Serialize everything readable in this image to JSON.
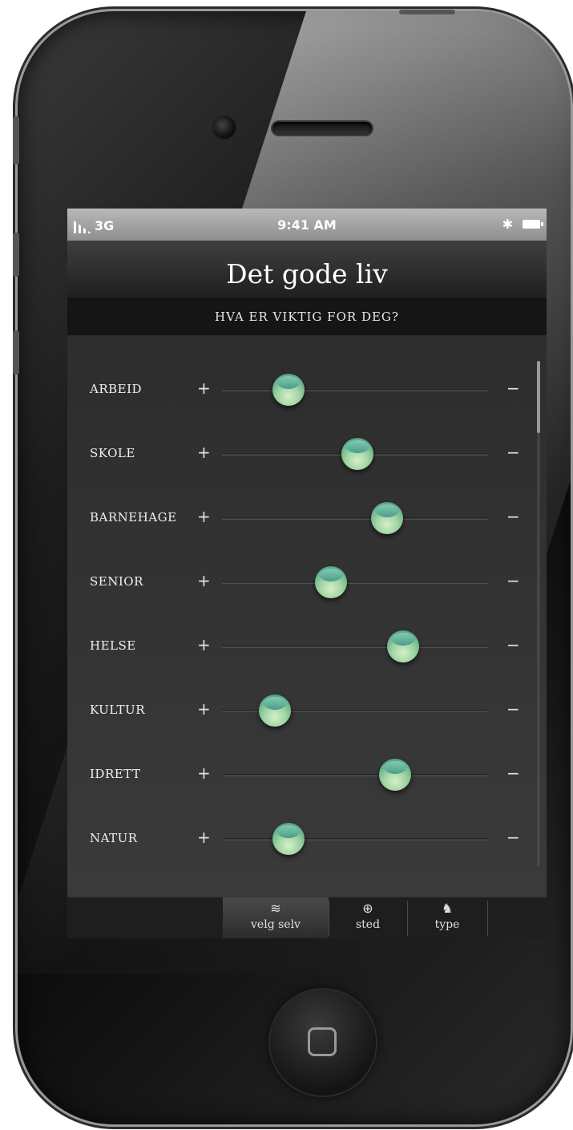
{
  "status_bar": {
    "network": "3G",
    "time": "9:41 AM"
  },
  "app": {
    "title": "Det gode liv",
    "subtitle": "HVA ER VIKTIG FOR DEG?"
  },
  "sliders": [
    {
      "label": "ARBEID",
      "plus": "+",
      "minus": "−",
      "value_percent": 25
    },
    {
      "label": "SKOLE",
      "plus": "+",
      "minus": "−",
      "value_percent": 51
    },
    {
      "label": "BARNEHAGE",
      "plus": "+",
      "minus": "−",
      "value_percent": 62
    },
    {
      "label": "SENIOR",
      "plus": "+",
      "minus": "−",
      "value_percent": 41
    },
    {
      "label": "HELSE",
      "plus": "+",
      "minus": "−",
      "value_percent": 68
    },
    {
      "label": "KULTUR",
      "plus": "+",
      "minus": "−",
      "value_percent": 20
    },
    {
      "label": "IDRETT",
      "plus": "+",
      "minus": "−",
      "value_percent": 65
    },
    {
      "label": "NATUR",
      "plus": "+",
      "minus": "−",
      "value_percent": 25
    }
  ],
  "tabs": [
    {
      "label": "velg selv",
      "icon": "sliders-icon",
      "glyph": "≋",
      "active": true
    },
    {
      "label": "sted",
      "icon": "crosshair-icon",
      "glyph": "⊕",
      "active": false
    },
    {
      "label": "type",
      "icon": "dog-icon",
      "glyph": "♞",
      "active": false
    }
  ],
  "colors": {
    "knob": "#8fd0a8",
    "background": "#2d2d2d"
  }
}
